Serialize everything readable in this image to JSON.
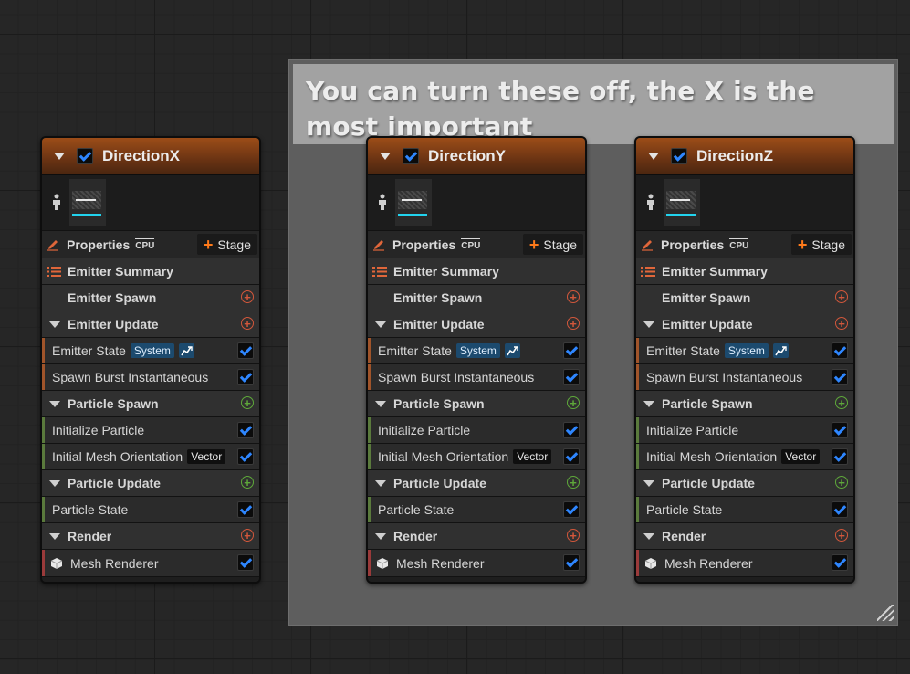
{
  "comment": {
    "title": "You can turn these off, the X is the most important"
  },
  "colors": {
    "accent_blue": "#2e86ff",
    "header_orange": "#9c4d18",
    "stage_plus": "#ff7a1a",
    "add_red": "#d2573b",
    "add_green": "#5ea83a"
  },
  "labels": {
    "properties": "Properties",
    "cpu": "CPU",
    "stage": "Stage",
    "emitter_summary": "Emitter Summary",
    "emitter_spawn": "Emitter Spawn",
    "emitter_update": "Emitter Update",
    "emitter_state": "Emitter State",
    "system_badge": "System",
    "spawn_burst": "Spawn Burst Instantaneous",
    "particle_spawn": "Particle Spawn",
    "initialize_particle": "Initialize Particle",
    "initial_mesh_orientation": "Initial Mesh Orientation",
    "vector_badge": "Vector",
    "particle_update": "Particle Update",
    "particle_state": "Particle State",
    "render": "Render",
    "mesh_renderer": "Mesh Renderer"
  },
  "emitters": [
    {
      "name": "DirectionX",
      "enabled": true
    },
    {
      "name": "DirectionY",
      "enabled": true
    },
    {
      "name": "DirectionZ",
      "enabled": true
    }
  ],
  "icons": [
    "collapse-arrow-icon",
    "person-icon",
    "pencil-icon",
    "cpu-icon",
    "plus-icon",
    "list-icon",
    "add-circle-icon",
    "link-arrow-icon",
    "cube-icon",
    "resize-grip-icon"
  ]
}
